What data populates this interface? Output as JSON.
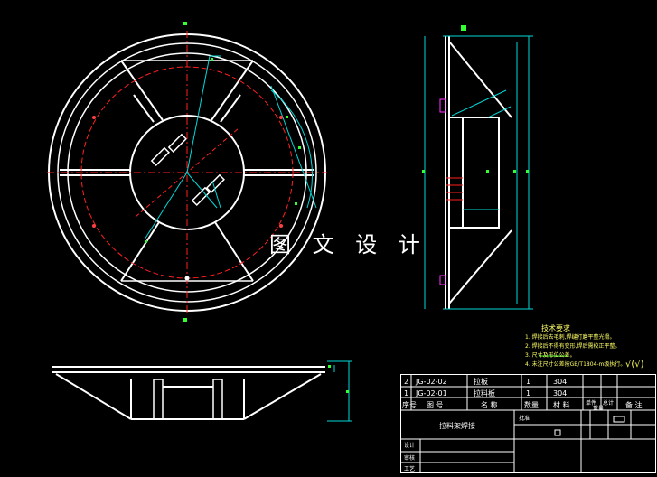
{
  "watermark": "图 文 设 计",
  "drawing_title": "拉料架焊接",
  "bom_rows": [
    {
      "seq": "2",
      "code": "JG-02-02",
      "name": "拉板",
      "qty": "1",
      "material": "304"
    },
    {
      "seq": "1",
      "code": "JG-02-01",
      "name": "拉料板",
      "qty": "1",
      "material": "304"
    }
  ],
  "bom_header": {
    "seq": "序号",
    "code": "图  号",
    "name": "名  称",
    "qty": "数量",
    "material": "材  料",
    "unit_weight": "单件",
    "total_weight": "总计",
    "weight": "重量",
    "remark": "备  注"
  },
  "tech_requirements": {
    "heading": "技术要求",
    "items": [
      "1. 焊接后去毛刺,焊缝打磨平整光滑。",
      "2. 焊接后不得有变形,焊后需校正平整。",
      "3. 尺寸及形位公差。",
      "4. 未注尺寸公差按GB/T1804-m级执行。"
    ]
  },
  "roughness_symbol": "√(√)",
  "title_block_labels": [
    "设计",
    "审核",
    "工艺",
    "批准"
  ],
  "colors": {
    "line": "#ffffff",
    "center": "#ff2020",
    "dim": "#00d8d8",
    "green": "#33ff33",
    "yellow": "#ffff66",
    "magenta": "#ff33ff"
  }
}
